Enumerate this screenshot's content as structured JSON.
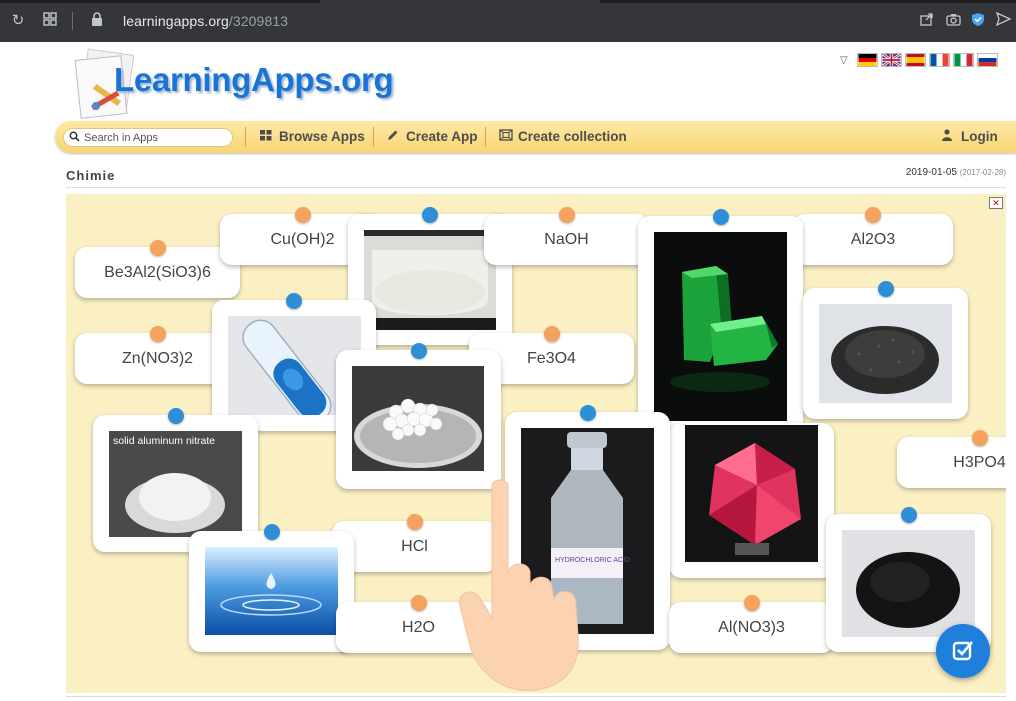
{
  "browser": {
    "url_host": "learningapps.org",
    "url_path": "/3209813"
  },
  "header": {
    "logo_text": "LearningApps.org",
    "languages": [
      "de",
      "en",
      "es",
      "fr",
      "it",
      "ru"
    ]
  },
  "nav": {
    "search_placeholder": "Search in Apps",
    "browse_label": "Browse Apps",
    "create_label": "Create App",
    "collection_label": "Create collection",
    "login_label": "Login"
  },
  "app": {
    "title": "Chimie",
    "date": "2019-01-05",
    "date_created": "(2017-02-28)"
  },
  "cards": {
    "be3al2": "Be3Al2(SiO3)6",
    "cuoh2": "Cu(OH)2",
    "naoh": "NaOH",
    "al2o3": "Al2O3",
    "zno32": "Zn(NO3)2",
    "fe3o4": "Fe3O4",
    "h3po4": "H3PO4",
    "hcl": "HCl",
    "h2o": "H2O",
    "alno33": "Al(NO3)3"
  },
  "images": {
    "aluminum_nitrate_caption": "solid aluminum nitrate",
    "bottle_caption": "HYDROCHLORIC ACID"
  },
  "colors": {
    "pin_orange": "#f4a25d",
    "pin_blue": "#2e8fd8",
    "nav_yellow": "#f8d574",
    "logo_blue": "#1a73d6",
    "check_button": "#1e7fdc"
  }
}
